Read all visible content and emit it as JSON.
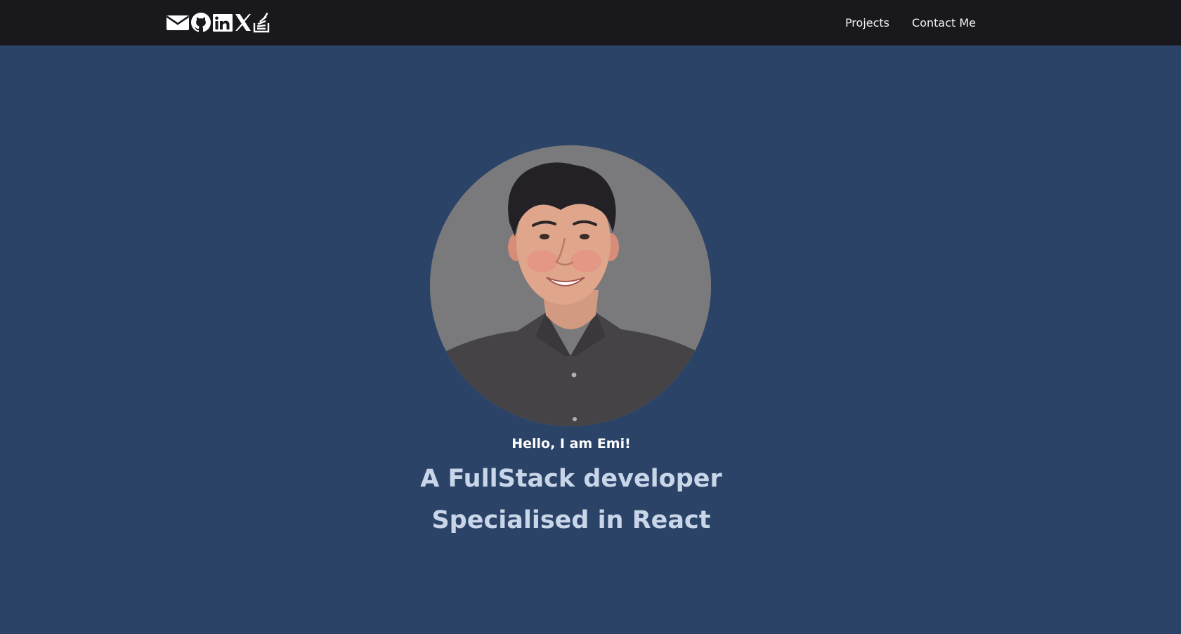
{
  "navbar": {
    "social_icons": [
      "mail-icon",
      "github-icon",
      "linkedin-icon",
      "x-icon",
      "stackoverflow-icon"
    ],
    "links": [
      "Projects",
      "Contact Me"
    ]
  },
  "hero": {
    "greeting": "Hello, I am Emi!",
    "headline_line1": "A FullStack developer",
    "headline_line2": "Specialised in React"
  },
  "colors": {
    "navbar_bg": "#18181d",
    "page_bg": "#2b4367",
    "greeting_text": "#ffffff",
    "headline_text": "#c9d6ea",
    "avatar_bg": "#7a7a7c"
  }
}
